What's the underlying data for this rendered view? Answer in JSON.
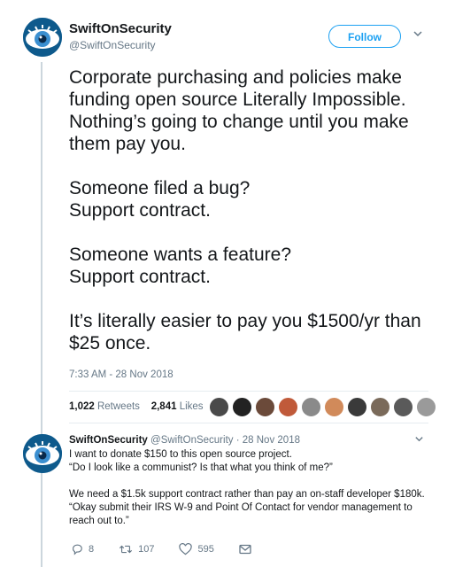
{
  "tweet": {
    "author_name": "SwiftOnSecurity",
    "author_handle": "@SwiftOnSecurity",
    "follow_label": "Follow",
    "paragraphs": [
      "Corporate purchasing and policies make funding open source Literally Impossible. Nothing’s going to change until you make them pay you.",
      "Someone filed a bug?\nSupport contract.",
      "Someone wants a feature?\nSupport contract.",
      "It’s literally easier to pay you $1500/yr than $25 once."
    ],
    "timestamp": "7:33 AM - 28 Nov 2018",
    "retweets_count": "1,022",
    "retweets_label": "Retweets",
    "likes_count": "2,841",
    "likes_label": "Likes"
  },
  "reply": {
    "author_name": "SwiftOnSecurity",
    "author_handle": "@SwiftOnSecurity",
    "separator": "·",
    "date": "28 Nov 2018",
    "lines": [
      "I want to donate $150 to this open source project.",
      "“Do I look like a communist? Is that what you think of me?”",
      "We need a $1.5k support contract rather than pay an on-staff developer $180k.",
      "“Okay submit their IRS W-9 and Point Of Contact for vendor management to reach out to.”"
    ],
    "reply_count": "8",
    "retweet_count": "107",
    "like_count": "595"
  },
  "colors": {
    "accent": "#1da1f2",
    "muted": "#657786",
    "text": "#14171a",
    "divider": "#e6ecf0"
  },
  "likers": [
    {
      "color": "#4a4a4a"
    },
    {
      "color": "#222222"
    },
    {
      "color": "#6b4a3a"
    },
    {
      "color": "#c05a3a"
    },
    {
      "color": "#8a8a8a"
    },
    {
      "color": "#d18a5a"
    },
    {
      "color": "#3a3a3a"
    },
    {
      "color": "#7a6a5a"
    },
    {
      "color": "#5a5a5a"
    },
    {
      "color": "#9a9a9a"
    }
  ]
}
